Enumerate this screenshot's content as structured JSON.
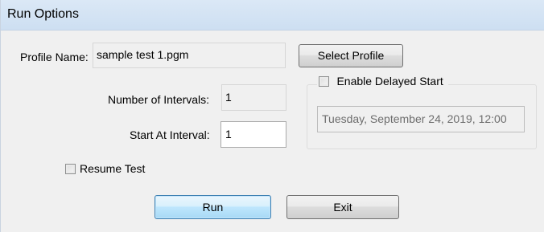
{
  "window": {
    "title": "Run Options"
  },
  "profile": {
    "label": "Profile Name:",
    "value": "sample test 1.pgm",
    "select_button": "Select Profile"
  },
  "intervals": {
    "number_label": "Number of Intervals:",
    "number_value": "1",
    "start_label": "Start At Interval:",
    "start_value": "1"
  },
  "delayed_start": {
    "label": "Enable Delayed Start",
    "checked": false,
    "datetime": "Tuesday, September 24, 2019, 12:00"
  },
  "resume": {
    "label": "Resume Test",
    "checked": false
  },
  "buttons": {
    "run": "Run",
    "exit": "Exit"
  }
}
